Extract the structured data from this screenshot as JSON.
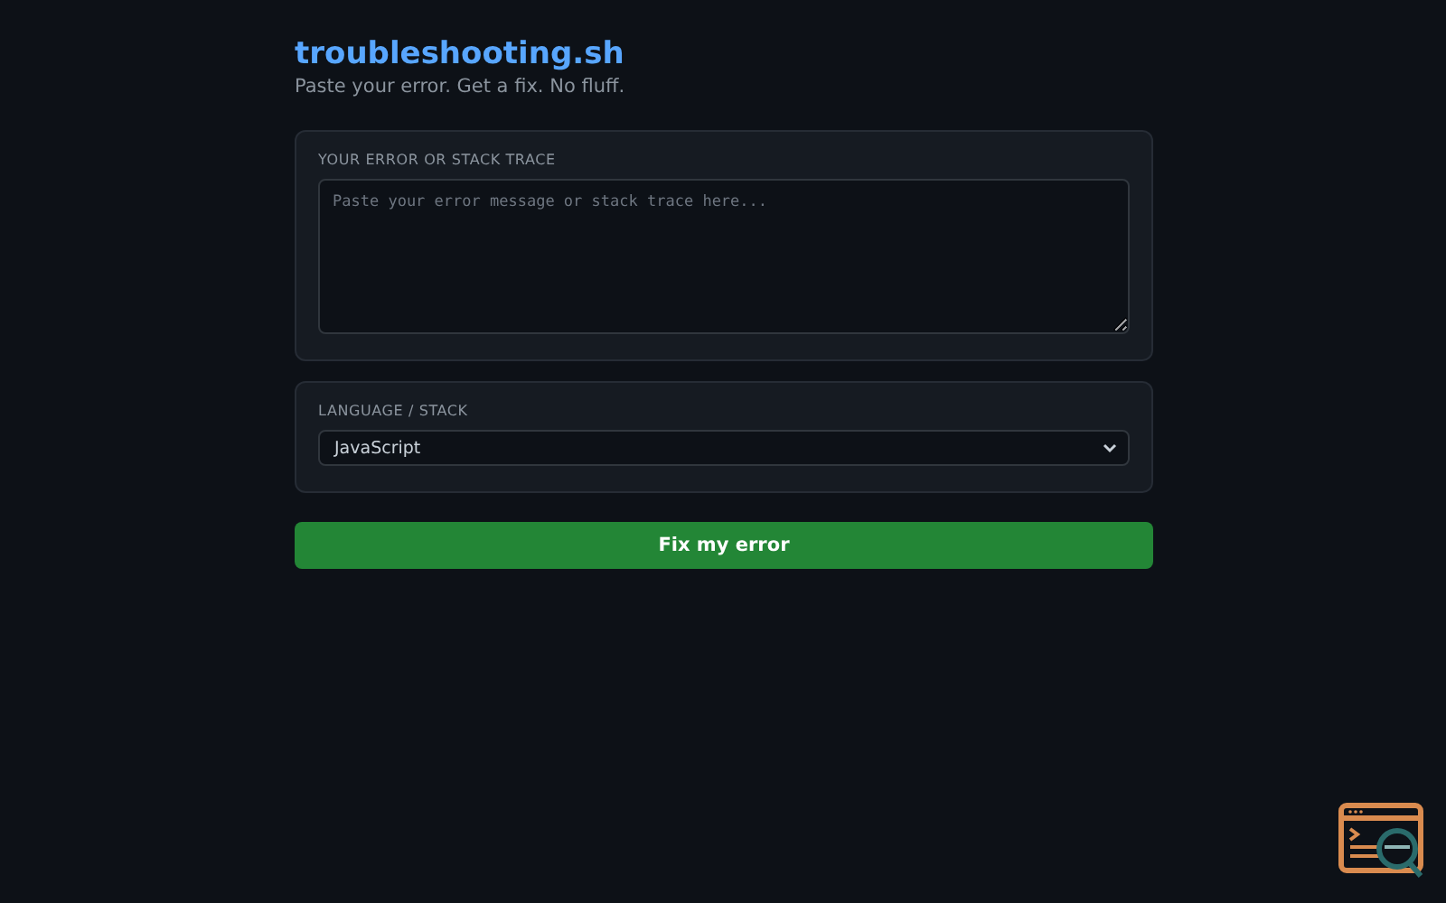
{
  "header": {
    "title": "troubleshooting.sh",
    "tagline": "Paste your error. Get a fix. No fluff."
  },
  "error_input": {
    "label": "YOUR ERROR OR STACK TRACE",
    "placeholder": "Paste your error message or stack trace here..."
  },
  "language": {
    "label": "LANGUAGE / STACK",
    "value": "JavaScript"
  },
  "submit_button": "Fix my error"
}
